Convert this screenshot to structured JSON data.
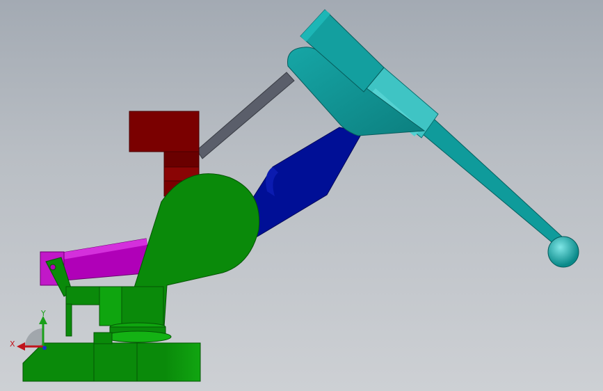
{
  "triad": {
    "x_label": "X",
    "y_label": "Y",
    "colors": {
      "x": "#c0141c",
      "y": "#1aa01a",
      "z": "#1a30c8"
    },
    "icon": "axis-triad-icon"
  },
  "model_colors": {
    "base": "#0a8a0a",
    "base_dark": "#067006",
    "cylinder": "#b000b8",
    "counterweight": "#7a0000",
    "lower_link": "#000f96",
    "upper_arm": "#0f9b9b",
    "upper_arm_light": "#3fc4c4",
    "rod": "#5a5e6a",
    "ball": "#14a8a8"
  }
}
